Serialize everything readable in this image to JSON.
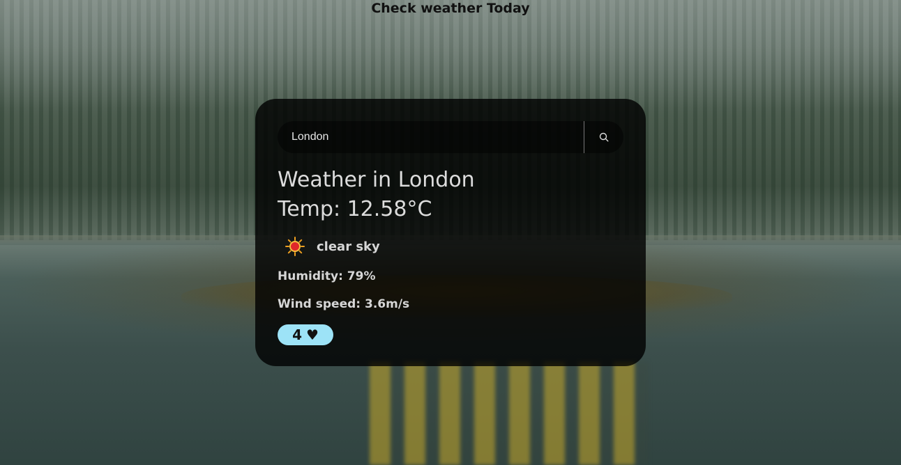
{
  "page": {
    "heading": "Check weather Today"
  },
  "search": {
    "value": "London",
    "icon": "search-icon"
  },
  "weather": {
    "city_line": "Weather in London",
    "temp_line": "Temp: 12.58°C",
    "description": "clear sky",
    "icon": "sun-icon",
    "humidity_line": "Humidity: 79%",
    "wind_line": "Wind speed: 3.6m/s"
  },
  "likes": {
    "count": "4",
    "symbol": "♥"
  },
  "colors": {
    "card_bg": "#000000",
    "text": "#dcdcdc",
    "likes_bg": "#9de3f7"
  }
}
